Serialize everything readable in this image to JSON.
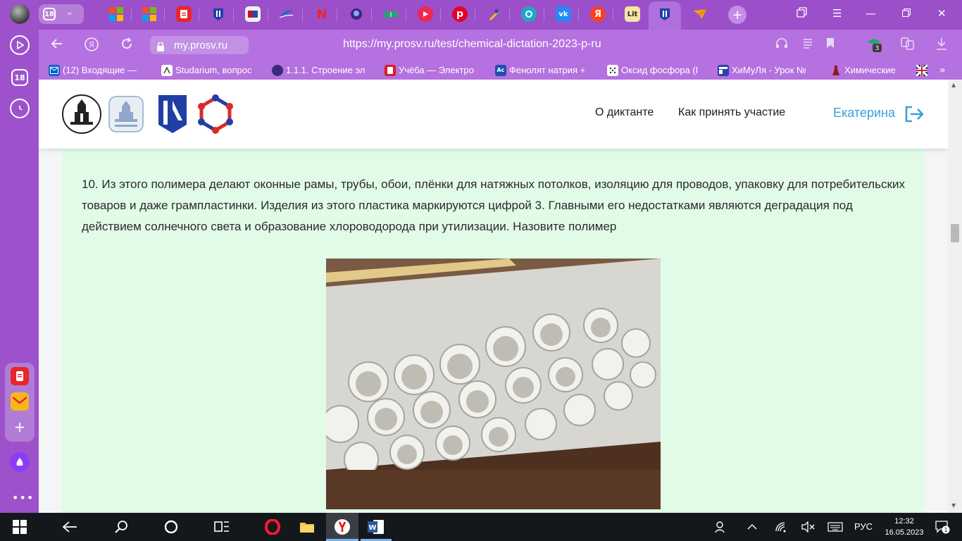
{
  "browser": {
    "tab_count": "18",
    "sidebar_badge": "18",
    "domain": "my.prosv.ru",
    "url": "https://my.prosv.ru/test/chemical-dictation-2023-p-ru",
    "downloads_badge": "3",
    "bookmarks": [
      {
        "label": "(12) Входящие — ",
        "icon": "mail-icon",
        "color": "#0a62c7"
      },
      {
        "label": "Studarium, вопрос",
        "icon": "studarium-icon",
        "color": "#ffffff"
      },
      {
        "label": "1.1.1. Строение эл",
        "icon": "lesson-icon",
        "color": "#3a2a7a"
      },
      {
        "label": "Учёба — Электро",
        "icon": "notes-icon",
        "color": "#d71e2a"
      },
      {
        "label": "Фенолят натрия +",
        "icon": "chem-icon",
        "color": "#1c4fb4"
      },
      {
        "label": "Оксид фосфора (I",
        "icon": "dots-icon",
        "color": "#ffffff"
      },
      {
        "label": "ХиМуЛя - Урок №",
        "icon": "table-icon",
        "color": "#2b43a6"
      },
      {
        "label": "Химические",
        "icon": "flask-icon",
        "color": "#8b1a1a"
      }
    ]
  },
  "site": {
    "nav": {
      "about": "О диктанте",
      "how_to": "Как принять участие"
    },
    "user_name": "Екатерина"
  },
  "question": {
    "text": "10. Из этого полимера делают оконные рамы, трубы, обои, плёнки для натяжных потолков, изоляцию для проводов, упаковку для потребительских товаров и даже грампластинки. Изделия из этого пластика маркируются цифрой 3. Главными его недостатками являются деградация под действием солнечного света и образование хлороводорода при утилизации. Назовите полимер"
  },
  "taskbar": {
    "language": "РУС",
    "time": "12:32",
    "date": "16.05.2023",
    "notifications": "1"
  }
}
